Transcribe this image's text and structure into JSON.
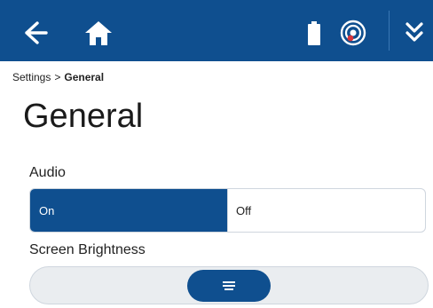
{
  "header": {
    "background_color": "#0f4f8f",
    "icons": {
      "back": "back-arrow-icon",
      "home": "home-icon",
      "battery": "battery-icon",
      "target": "target-icon",
      "menu": "double-chevron-down-icon"
    }
  },
  "breadcrumb": {
    "parent": "Settings",
    "separator": ">",
    "current": "General"
  },
  "page": {
    "title": "General"
  },
  "audio": {
    "label": "Audio",
    "options": [
      {
        "label": "On",
        "selected": true
      },
      {
        "label": "Off",
        "selected": false
      }
    ]
  },
  "brightness": {
    "label": "Screen Brightness",
    "level_fraction": 0.5
  },
  "colors": {
    "accent": "#0f4f8f",
    "track": "#eaedf0",
    "border": "#cfd6de"
  }
}
